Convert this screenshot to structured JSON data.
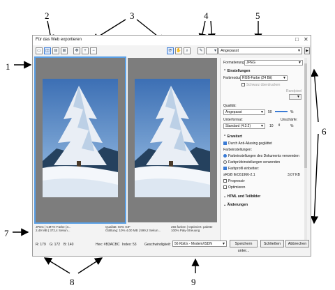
{
  "window": {
    "title": "Für das Web exportieren",
    "maximize": "□",
    "close": "✕"
  },
  "toolbar": {
    "preset_value": "Angepasst"
  },
  "settings": {
    "format_label": "Formatierung:",
    "format_value": "JPEG",
    "section_settings": "Einstellungen",
    "colormode_label": "Farbmodus:",
    "colormode_value": "RGB-Farbe (24 Bit)",
    "black_overprint": "Schwarz überdrucken",
    "edge_label": "Randpixel",
    "quality_label": "Qualität:",
    "quality_value": "Angepasst",
    "quality_number": "50",
    "quality_unit": "%",
    "subformat_label": "Unterformat:",
    "blur_label": "Unschärfe:",
    "subformat_value": "Standard (4:2:2)",
    "blur_number": "10",
    "blur_unit": "%",
    "section_advanced": "Erweitert",
    "antialias": "Durch Anti-Aliasing geglättet",
    "color_settings_label": "Farbeinstellungen:",
    "opt_document_colors": "Farbeinstellungen des Dokuments verwenden",
    "opt_proof_colors": "Farbprüfeinstellungen verwenden",
    "embed_profile": "Farbprofil einbetten:",
    "profile_name": "sRGB IEC61966-2.1",
    "profile_size": "3,07 KB",
    "progressive": "Progressiv",
    "optimize": "Optimieren",
    "section_html": "HTML und Teilbilder",
    "section_changes": "Änderungen"
  },
  "info_left": {
    "line1": "JPEG  |  CMYK-Farbe (3...",
    "line2": "2,49 MB  |  372,4 Sekun..."
  },
  "info_right": {
    "line1a": "Qualität: 50%  GIF",
    "line1b": "256 farben  |  Optimiert: palette",
    "line2a": "Glättung: 10%  4,00 MB  |  599,2 Sekun...",
    "line2b": "100% Paly-Streuung"
  },
  "status": {
    "r": "R: 179",
    "g": "G: 172",
    "b": "B: 140",
    "hex": "Hex: #B3ACBC",
    "index": "Index: 53"
  },
  "footer": {
    "speed_label": "Geschwindigkeit:",
    "speed_value": "56 Kbit/s - Modem/ISDN",
    "save_button": "Speichern unter...",
    "close_button": "Schließen",
    "cancel_button": "Abbrechen"
  },
  "annotations": [
    "1",
    "2",
    "3",
    "4",
    "5",
    "6",
    "7",
    "8",
    "9"
  ],
  "colors": {
    "accent": "#3a7bd5",
    "preview_bg": "#7d7d7d",
    "selection_frame": "#5aa0e6"
  }
}
